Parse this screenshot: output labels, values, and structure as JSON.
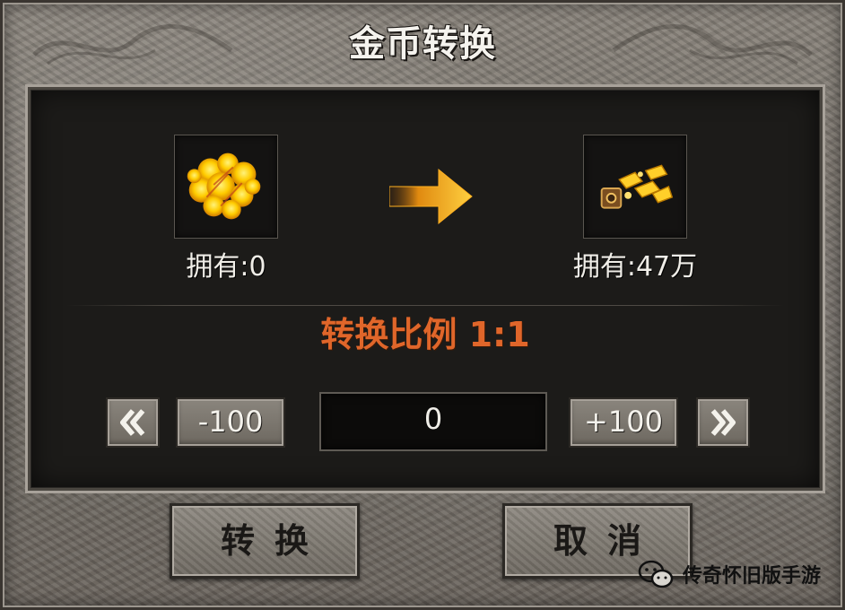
{
  "window": {
    "title": "金币转换"
  },
  "source": {
    "icon": "gold-nuggets-icon",
    "owned_label": "拥有:0"
  },
  "target": {
    "icon": "gold-ingot-chest-icon",
    "owned_label": "拥有:47万"
  },
  "ratio_label": "转换比例 1:1",
  "stepper": {
    "min_icon": "double-chevron-left-icon",
    "minus_label": "-100",
    "amount_value": "0",
    "plus_label": "+100",
    "max_icon": "double-chevron-right-icon"
  },
  "actions": {
    "convert_label": "转换",
    "cancel_label": "取消"
  },
  "watermark": {
    "icon": "wechat-icon",
    "text": "传奇怀旧版手游"
  },
  "colors": {
    "ratio": "#e0662a",
    "arrow": "#f5a623",
    "panel": "#1c1b19"
  }
}
